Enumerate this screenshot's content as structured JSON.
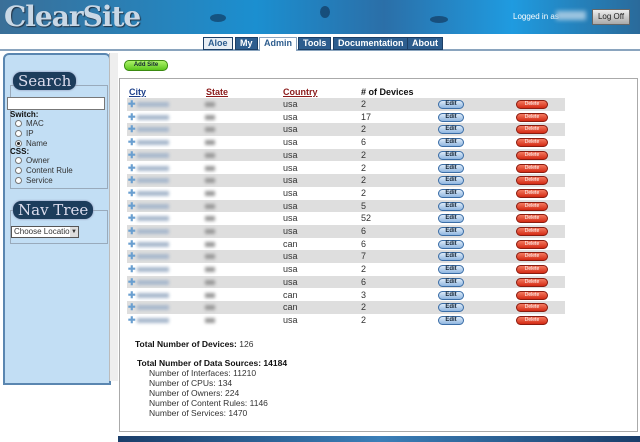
{
  "header": {
    "logo": "ClearSite",
    "logged_in_label": "Logged in as",
    "logoff_label": "Log Off"
  },
  "tabs": [
    {
      "label": "Aloe"
    },
    {
      "label": "My"
    },
    {
      "label": "Admin",
      "active": true
    },
    {
      "label": "Tools"
    },
    {
      "label": "Documentation"
    },
    {
      "label": "About"
    }
  ],
  "sidebar": {
    "search_title": "Search",
    "search_value": "",
    "switch_label": "Switch:",
    "switch_options": [
      "MAC",
      "IP",
      "Name"
    ],
    "switch_selected": "Name",
    "css_label": "CSS:",
    "css_options": [
      "Owner",
      "Content Rule",
      "Service"
    ],
    "navtree_title": "Nav Tree",
    "location_select": "Choose Location"
  },
  "main": {
    "add_site_label": "Add Site",
    "columns": {
      "city": "City",
      "state": "State",
      "country": "Country",
      "devices": "# of Devices"
    },
    "edit_label": "Edit",
    "delete_label": "Delete",
    "rows": [
      {
        "country": "usa",
        "devices": "2"
      },
      {
        "country": "usa",
        "devices": "17"
      },
      {
        "country": "usa",
        "devices": "2"
      },
      {
        "country": "usa",
        "devices": "6"
      },
      {
        "country": "usa",
        "devices": "2"
      },
      {
        "country": "usa",
        "devices": "2"
      },
      {
        "country": "usa",
        "devices": "2"
      },
      {
        "country": "usa",
        "devices": "2"
      },
      {
        "country": "usa",
        "devices": "5"
      },
      {
        "country": "usa",
        "devices": "52"
      },
      {
        "country": "usa",
        "devices": "6"
      },
      {
        "country": "can",
        "devices": "6"
      },
      {
        "country": "usa",
        "devices": "7"
      },
      {
        "country": "usa",
        "devices": "2"
      },
      {
        "country": "usa",
        "devices": "6"
      },
      {
        "country": "can",
        "devices": "3"
      },
      {
        "country": "can",
        "devices": "2"
      },
      {
        "country": "usa",
        "devices": "2"
      }
    ],
    "totals": {
      "devices_label": "Total Number of Devices:",
      "devices": "126",
      "sources_label": "Total Number of Data Sources: 14184",
      "lines": [
        "Number of Interfaces: 11210",
        "Number of CPUs: 134",
        "Number of Owners: 224",
        "Number of Content Rules: 1146",
        "Number of Services: 1470"
      ]
    }
  }
}
